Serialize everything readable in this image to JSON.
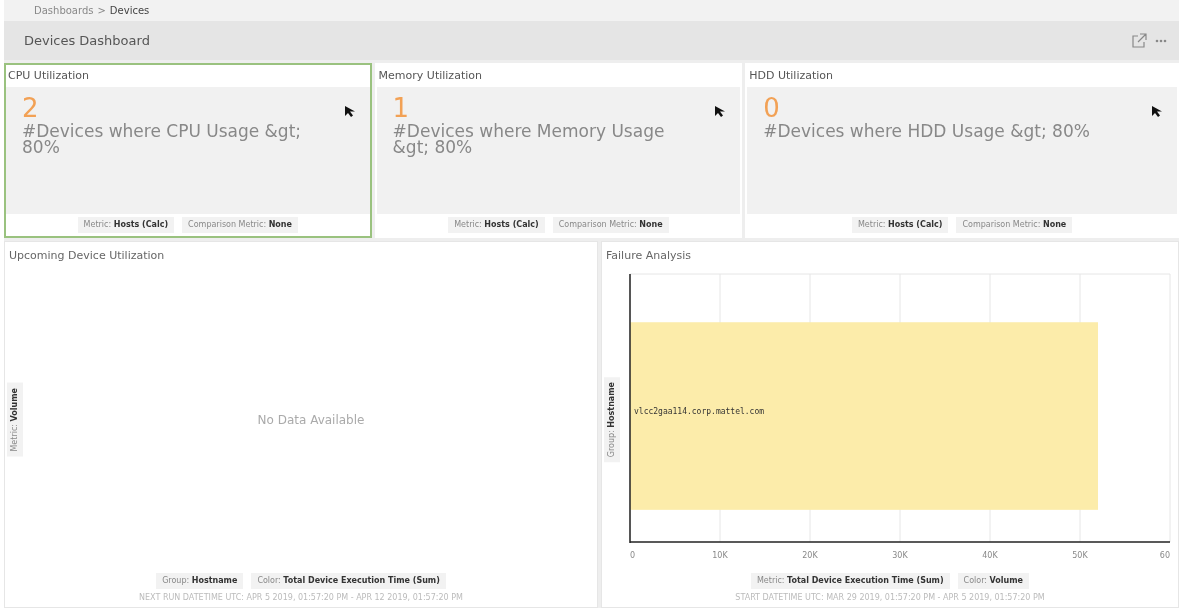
{
  "breadcrumb": [
    {
      "label": "Dashboards",
      "current": false
    },
    {
      "label": "Devices",
      "current": true
    }
  ],
  "breadcrumb_separator": ">",
  "header": {
    "title": "Devices Dashboard"
  },
  "kpis": [
    {
      "title": "CPU Utilization",
      "value": "2",
      "caption": "#Devices where CPU Usage &gt; 80%",
      "selected": true,
      "footer": [
        "Metric: **Hosts (Calc)**",
        "Comparison Metric: **None**"
      ]
    },
    {
      "title": "Memory Utilization",
      "value": "1",
      "caption": "#Devices where Memory Usage &gt; 80%",
      "selected": false,
      "footer": [
        "Metric: **Hosts (Calc)**",
        "Comparison Metric: **None**"
      ]
    },
    {
      "title": "HDD Utilization",
      "value": "0",
      "caption": "#Devices where HDD Usage &gt; 80%",
      "selected": false,
      "footer": [
        "Metric: **Hosts (Calc)**",
        "Comparison Metric: **None**"
      ]
    }
  ],
  "upcoming": {
    "title": "Upcoming Device Utilization",
    "axis_label": "Metric: **Volume**",
    "empty_message": "No Data Available",
    "footer": [
      "Group: **Hostname**",
      "Color: **Total Device Execution Time (Sum)**"
    ],
    "date_range": "NEXT RUN DATETIME UTC: APR 5 2019, 01:57:20 PM - APR 12 2019, 01:57:20 PM"
  },
  "failure": {
    "title": "Failure Analysis",
    "axis_label": "Group: **Hostname**",
    "chart_data": {
      "type": "bar",
      "orientation": "horizontal",
      "categories": [
        "vlcc2gaa114.corp.mattel.com"
      ],
      "series": [
        {
          "color": "#fcecaa",
          "values": [
            52
          ]
        }
      ],
      "xlim": [
        0,
        60
      ],
      "grid": true,
      "xticks": [
        {
          "value": 0,
          "label": "0"
        },
        {
          "value": 10,
          "label": "10K"
        },
        {
          "value": 20,
          "label": "20K"
        },
        {
          "value": 30,
          "label": "30K"
        },
        {
          "value": 40,
          "label": "40K"
        },
        {
          "value": 50,
          "label": "50K"
        },
        {
          "value": 60,
          "label": "60"
        }
      ]
    },
    "footer": [
      "Metric: **Total Device Execution Time (Sum)**",
      "Color: **Volume**"
    ],
    "date_range": "START DATETIME UTC: MAR 29 2019, 01:57:20 PM - APR 5 2019, 01:57:20 PM"
  }
}
